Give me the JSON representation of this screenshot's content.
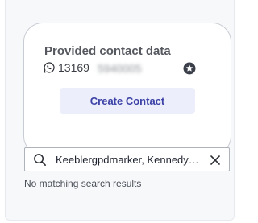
{
  "contact_card": {
    "title": "Provided contact data",
    "phone_visible": "13169",
    "phone_obscured": "5940005",
    "phone_icon": "whatsapp-icon",
    "badge_icon": "star-icon",
    "create_button_label": "Create Contact"
  },
  "search": {
    "value": "Keeblergpdmarker, Kennedyg…",
    "icon": "search-icon",
    "clear_icon": "close-icon"
  },
  "results": {
    "empty_message": "No matching search results"
  },
  "colors": {
    "accent": "#3c42a6",
    "button_bg": "#eceefb",
    "card_border": "#c9ccd3"
  }
}
